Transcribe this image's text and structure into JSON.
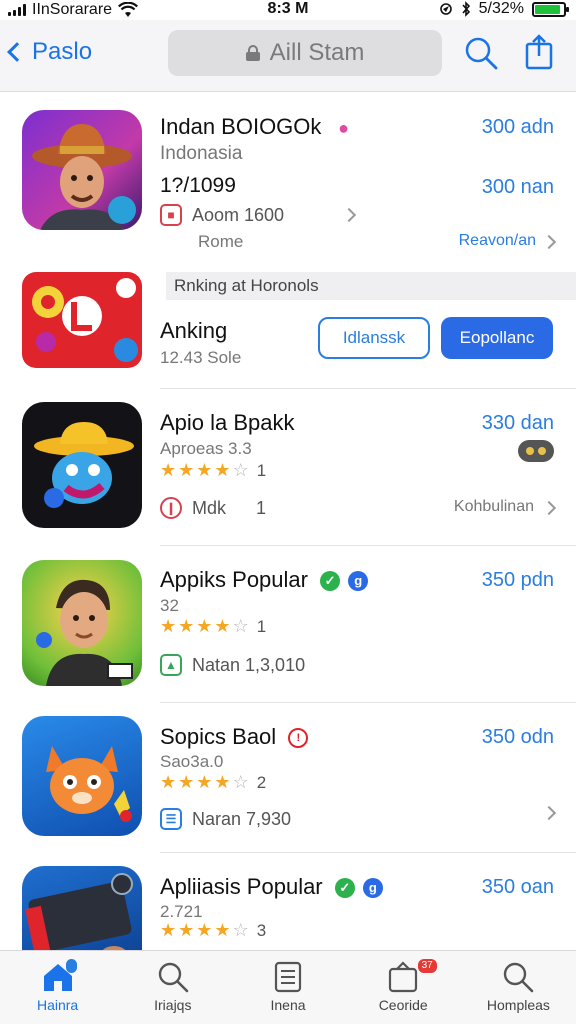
{
  "status_bar": {
    "carrier": "IInSorarare",
    "time": "8:3 M",
    "battery_text": "5/32%",
    "battery_level": 0.9
  },
  "nav": {
    "back_label": "Paslo",
    "search_text": "Aill Stam"
  },
  "ranking_header": "Rnking at Horonols",
  "apps": [
    {
      "name": "Indan BOIOGOk",
      "subtitle": "Indonasia",
      "extra": "1?/1099",
      "price": "300 adn",
      "price2": "300 nan",
      "meta_text": "Aoom 1600",
      "meta2": "Rome",
      "link": "Reavon/an"
    },
    {
      "name": "Anking",
      "subtitle": "12.43 Sole",
      "btn_outline": "Idlanssk",
      "btn_solid": "Eopollanc"
    },
    {
      "name": "Apio la Bpakk",
      "subtitle": "Aproeas 3.3",
      "price": "330 dan",
      "rating": 4,
      "rating_count": "1",
      "meta_text": "Mdk",
      "meta_num": "1",
      "link": "Kohbulinan"
    },
    {
      "name": "Appiks Popular",
      "subtitle": "32",
      "price": "350 pdn",
      "rating": 4,
      "rating_count": "1",
      "meta_text": "Natan 1,3,010"
    },
    {
      "name": "Sopics Baol",
      "subtitle": "Sao3a.0",
      "price": "350 odn",
      "rating": 4,
      "rating_count": "2",
      "meta_text": "Naran 7,930"
    },
    {
      "name": "Apliiasis Popular",
      "subtitle": "2.721",
      "price": "350 oan",
      "rating": 4,
      "rating_count": "3"
    }
  ],
  "tabs": [
    {
      "label": "Hainra",
      "icon": "home-icon",
      "active": true
    },
    {
      "label": "Iriajqs",
      "icon": "search-icon"
    },
    {
      "label": "Inena",
      "icon": "document-icon"
    },
    {
      "label": "Ceoride",
      "icon": "box-icon",
      "badge": "37"
    },
    {
      "label": "Hompleas",
      "icon": "search-icon"
    }
  ],
  "colors": {
    "accent": "#2a7de1",
    "star": "#f5a623"
  }
}
